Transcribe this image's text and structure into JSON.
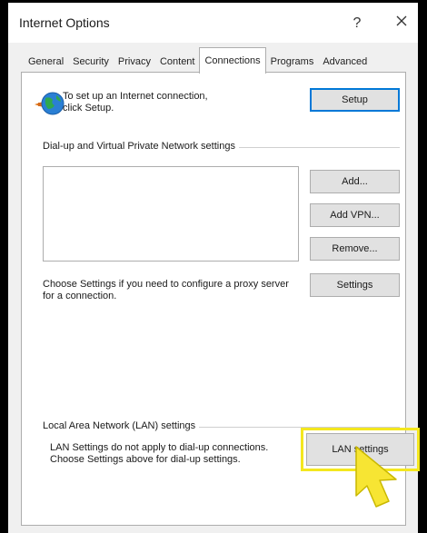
{
  "window": {
    "title": "Internet Options",
    "help_glyph": "?",
    "close_glyph": "×"
  },
  "tabs": [
    {
      "label": "General"
    },
    {
      "label": "Security"
    },
    {
      "label": "Privacy"
    },
    {
      "label": "Content"
    },
    {
      "label": "Connections",
      "active": true
    },
    {
      "label": "Programs"
    },
    {
      "label": "Advanced"
    }
  ],
  "setup": {
    "text": "To set up an Internet connection, click Setup.",
    "button_label": "Setup"
  },
  "dialup": {
    "group_label": "Dial-up and Virtual Private Network settings",
    "add_label": "Add...",
    "add_vpn_label": "Add VPN...",
    "remove_label": "Remove...",
    "settings_text": "Choose Settings if you need to configure a proxy server for a connection.",
    "settings_label": "Settings"
  },
  "lan": {
    "group_label": "Local Area Network (LAN) settings",
    "text": "LAN Settings do not apply to dial-up connections. Choose Settings above for dial-up settings.",
    "button_label": "LAN settings"
  },
  "colors": {
    "highlight": "#f4e71f",
    "pointer": "#f7e533",
    "focus_border": "#0078d7"
  },
  "icons": {
    "globe": "globe-network-icon",
    "pointer": "pointer-arrow-icon"
  }
}
